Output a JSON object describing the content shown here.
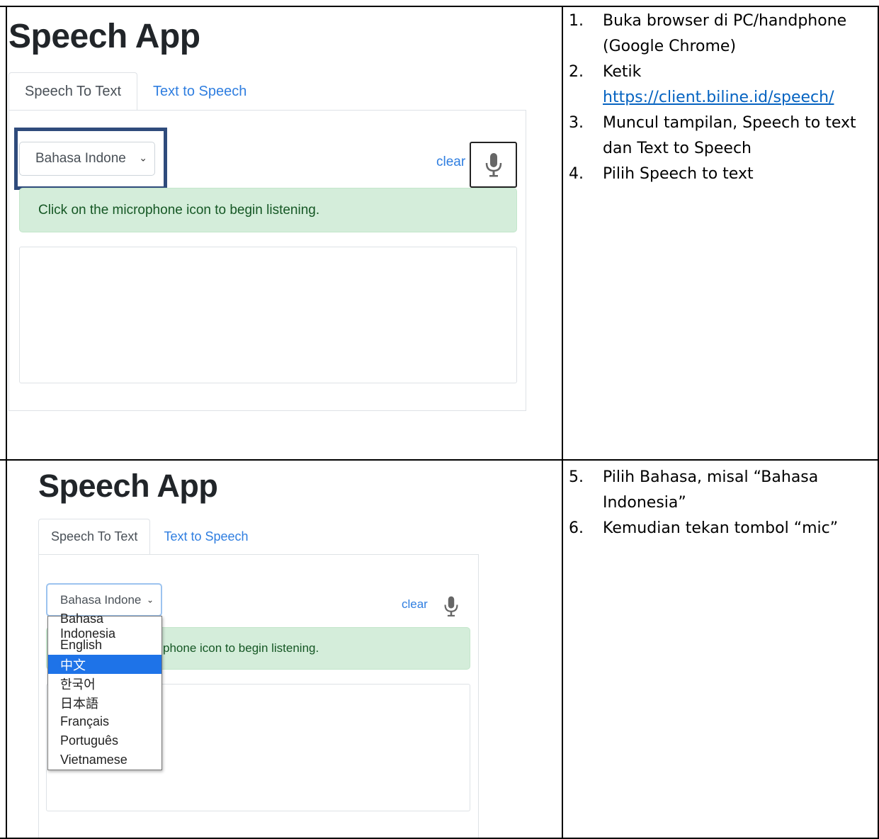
{
  "panel_top": {
    "app_title": "Speech App",
    "tabs": [
      "Speech To Text",
      "Text to Speech"
    ],
    "language_select": "Bahasa Indone",
    "clear_label": "clear",
    "alert_text": "Click on the microphone icon to begin listening."
  },
  "panel_bottom": {
    "app_title": "Speech App",
    "tabs": [
      "Speech To Text",
      "Text to Speech"
    ],
    "language_select": "Bahasa Indone",
    "clear_label": "clear",
    "alert_text_visible": "phone icon to begin listening.",
    "dropdown_options": [
      "Bahasa Indonesia",
      "English",
      "中文",
      "한국어",
      "日本語",
      "Français",
      "Português",
      "Vietnamese"
    ],
    "highlighted_option": "中文"
  },
  "instructions_top": [
    {
      "num": "1.",
      "text": "Buka browser di PC/handphone (Google Chrome)"
    },
    {
      "num": "2.",
      "text": "Ketik",
      "link": "https://client.biline.id/speech/"
    },
    {
      "num": "3.",
      "text": "Muncul tampilan, Speech to text dan Text to Speech"
    },
    {
      "num": "4.",
      "text": "Pilih Speech to text"
    }
  ],
  "instructions_bottom": [
    {
      "num": "5.",
      "text": "Pilih Bahasa, misal “Bahasa Indonesia”"
    },
    {
      "num": "6.",
      "text": "Kemudian tekan tombol “mic”"
    }
  ],
  "colors": {
    "link_blue": "#2f7ee0",
    "alert_bg": "#d4edda",
    "alert_text": "#155724",
    "highlight_border": "#2f4b7c",
    "dropdown_selected": "#1e73e8",
    "doc_link": "#0563c1"
  }
}
